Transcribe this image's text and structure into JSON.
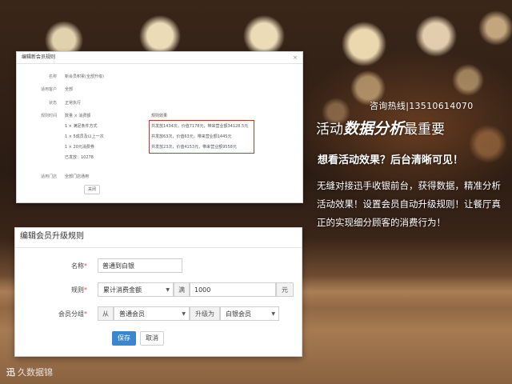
{
  "top_dialog": {
    "title": "编辑新会员规则",
    "rows": [
      {
        "label": "名称",
        "value": "新会员积累(全部升级)"
      },
      {
        "label": "适用客户",
        "value": "全部"
      },
      {
        "label": "状态",
        "value": "正常执行"
      },
      {
        "label": "规则时间",
        "value": "数量 × 消费额"
      }
    ],
    "result_header": "规则效果",
    "rule_items": [
      "1 × 满足条件方式",
      "1 × 5成员及以上一次",
      "1 × 20元消费券"
    ],
    "rule_results": [
      "共发放1434次，价值7178元，带来营业额34128.5元",
      "共发放63次，价值63元，带来营业额1445元",
      "共发放23次，价值4153元，带来营业额9558元"
    ],
    "extra_line": "已发放：10278",
    "store_label": "适用门店",
    "store_value": "全部门店通用",
    "button": "关闭"
  },
  "bottom_dialog": {
    "title": "编辑会员升级规则",
    "name_label": "名称",
    "name_value": "普通到白银",
    "rule_label": "规则",
    "rule_select": "累计消费金额",
    "rule_op": "满",
    "rule_amount": "1000",
    "rule_unit": "元",
    "group_label": "会员分组",
    "from_label": "从",
    "from_value": "普通会员",
    "upgrade_label": "升级为",
    "to_value": "白银会员",
    "save": "保存",
    "cancel": "取消"
  },
  "right_panel": {
    "hotline": "咨询热线|13510614070",
    "headline_pre": "活动",
    "headline_accent": "数据分析",
    "headline_post": "最重要",
    "subhead": "想看活动效果？后台清晰可见！",
    "description": "无缝对接迅手收银前台，获得数据，精准分析活动效果！设置会员自动升级规则！让餐厅真正的实现细分顾客的消费行为！"
  },
  "logo": {
    "mark": "迅",
    "text": "久数据锦"
  }
}
